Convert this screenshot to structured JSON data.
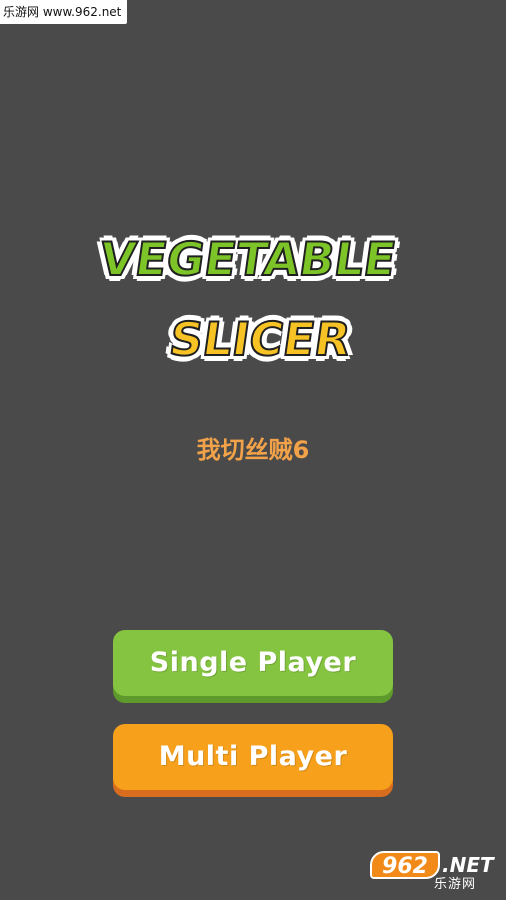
{
  "watermark": {
    "top_text": "乐游网 www.962.net",
    "badge_number": "962",
    "badge_domain": ".NET",
    "badge_cn": "乐游网"
  },
  "logo": {
    "line1": "VEGETABLE",
    "line2": "SLICER"
  },
  "player_name": "我切丝贼6",
  "buttons": {
    "single_player": "Single Player",
    "multi_player": "Multi Player"
  },
  "colors": {
    "background": "#4a4a4a",
    "logo_green": "#7cc427",
    "logo_yellow": "#f7c223",
    "player_name": "#f2a248",
    "single_button": "#85c441",
    "multi_button": "#f7a01c"
  }
}
